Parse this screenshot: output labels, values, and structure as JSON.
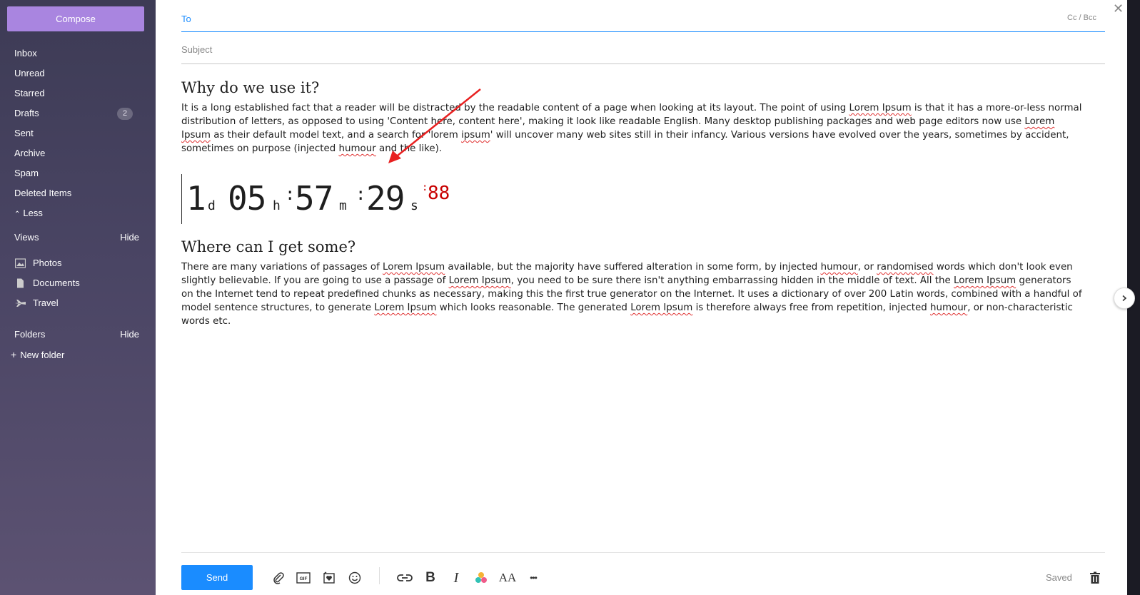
{
  "sidebar": {
    "compose_label": "Compose",
    "items": [
      {
        "label": "Inbox"
      },
      {
        "label": "Unread"
      },
      {
        "label": "Starred"
      },
      {
        "label": "Drafts",
        "badge": "2"
      },
      {
        "label": "Sent"
      },
      {
        "label": "Archive"
      },
      {
        "label": "Spam"
      },
      {
        "label": "Deleted Items"
      }
    ],
    "less_label": "Less",
    "views": {
      "title": "Views",
      "hide_label": "Hide",
      "items": [
        {
          "label": "Photos",
          "icon": "photo-icon"
        },
        {
          "label": "Documents",
          "icon": "document-icon"
        },
        {
          "label": "Travel",
          "icon": "plane-icon"
        }
      ]
    },
    "folders": {
      "title": "Folders",
      "hide_label": "Hide",
      "new_folder_label": "New folder"
    }
  },
  "compose": {
    "to_label": "To",
    "cc_bcc_label": "Cc / Bcc",
    "subject_placeholder": "Subject",
    "heading1": "Why do we use it?",
    "para1": {
      "t1": "It is a long established fact that a reader will be distracted by the readable content of a page when looking at its layout. The point of using ",
      "u1": "Lorem Ipsum",
      "t2": " is that it has a more-or-less normal distribution of letters, as opposed to using 'Content here, content here', making it look like readable English. Many desktop publishing packages and web page editors now use ",
      "u2": "Lorem Ipsum",
      "t3": " as their default model text, and a search for 'lorem ",
      "u3": "ipsum",
      "t4": "' will uncover many web sites still in their infancy. Various versions have evolved over the years, sometimes by accident, sometimes on purpose (injected ",
      "u4": "humour",
      "t5": " and the like)."
    },
    "countdown": {
      "days": "1",
      "days_unit": "d",
      "hours": "05",
      "hours_unit": "h",
      "minutes": "57",
      "minutes_unit": "m",
      "seconds": "29",
      "seconds_unit": "s",
      "fraction": "88",
      "sep": ":"
    },
    "heading2": "Where can I get some?",
    "para2": {
      "t1": "There are many variations of passages of ",
      "u1": "Lorem Ipsum",
      "t2": " available, but the majority have suffered alteration in some form, by injected ",
      "u2": "humour",
      "t3": ", or ",
      "u3": "randomised",
      "t4": " words which don't look even slightly believable. If you are going to use a passage of ",
      "u4": "Lorem Ipsum",
      "t5": ", you need to be sure there isn't anything embarrassing hidden in the middle of text. All the ",
      "u5": "Lorem Ipsum",
      "t6": " generators on the Internet tend to repeat predefined chunks as necessary, making this the first true generator on the Internet. It uses a dictionary of over 200 Latin words, combined with a handful of model sentence structures, to generate ",
      "u6": "Lorem Ipsum",
      "t7": " which looks reasonable. The generated ",
      "u7": "Lorem Ipsum",
      "t8": " is therefore always free from repetition, injected ",
      "u8": "humour",
      "t9": ", or non-characteristic words etc."
    }
  },
  "toolbar": {
    "send_label": "Send",
    "saved_label": "Saved",
    "gif_label": "GIF",
    "bold_label": "B",
    "italic_label": "I",
    "font_size_label": "AA",
    "more_label": "•••"
  },
  "colors": {
    "accent": "#1a8cff",
    "compose": "#a985e0",
    "countdown_fraction": "#c80000",
    "annotation_arrow": "#e82020"
  }
}
